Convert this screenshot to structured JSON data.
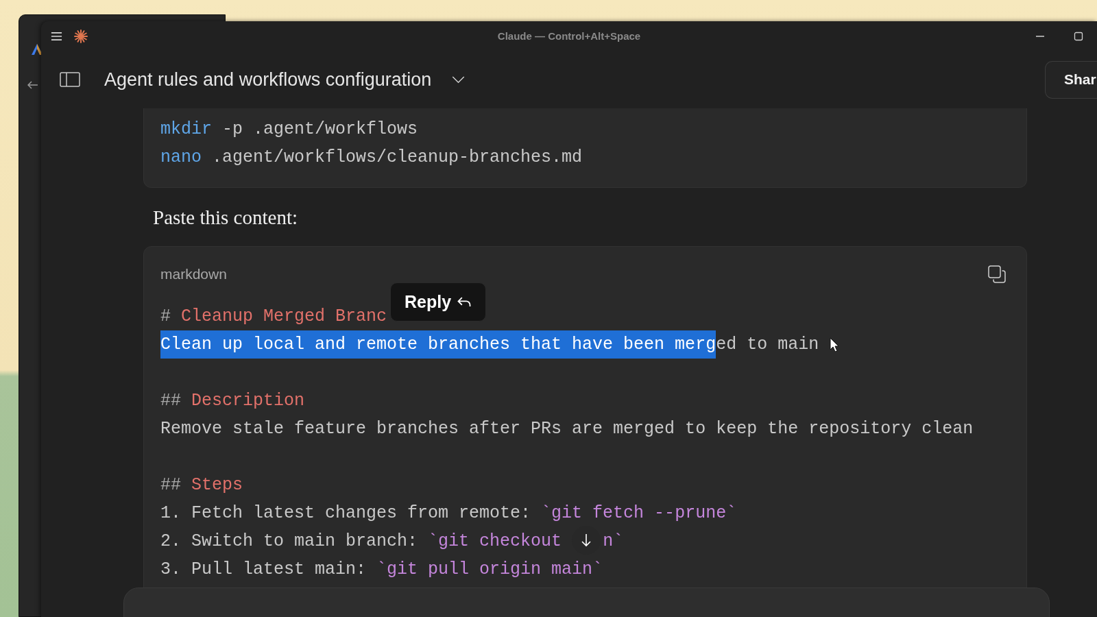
{
  "window": {
    "title": "Claude — Control+Alt+Space"
  },
  "header": {
    "title": "Agent rules and workflows configuration",
    "share_button": "Shar"
  },
  "command_block": {
    "lines": [
      {
        "kind": "code",
        "segments": [
          {
            "kind": "command",
            "text": "mkdir"
          },
          {
            "kind": "text",
            "text": " -p .agent/workflows"
          }
        ]
      },
      {
        "kind": "code",
        "segments": [
          {
            "kind": "command",
            "text": "nano"
          },
          {
            "kind": "text",
            "text": " .agent/workflows/cleanup-branches.md"
          }
        ]
      }
    ]
  },
  "paragraph": "Paste this content:",
  "code_block": {
    "language": "markdown",
    "reply_popup": "Reply",
    "lines": [
      {
        "kind": "code",
        "segments": [
          {
            "kind": "mark",
            "text": "# "
          },
          {
            "kind": "heading",
            "text": "Cleanup Merged Branc"
          }
        ]
      },
      {
        "kind": "code",
        "segments": [
          {
            "kind": "text",
            "text": "Clean up local and remote branches that have been merg",
            "selected": true
          },
          {
            "kind": "text",
            "text": "ed to main",
            "selected": false
          }
        ]
      },
      {
        "kind": "blank"
      },
      {
        "kind": "code",
        "segments": [
          {
            "kind": "mark",
            "text": "## "
          },
          {
            "kind": "heading",
            "text": "Description"
          }
        ]
      },
      {
        "kind": "code",
        "segments": [
          {
            "kind": "text",
            "text": "Remove stale feature branches after PRs are merged to keep the repository clean"
          }
        ]
      },
      {
        "kind": "blank"
      },
      {
        "kind": "code",
        "segments": [
          {
            "kind": "mark",
            "text": "## "
          },
          {
            "kind": "heading",
            "text": "Steps"
          }
        ]
      },
      {
        "kind": "code",
        "segments": [
          {
            "kind": "text",
            "text": "1. Fetch latest changes from remote: "
          },
          {
            "kind": "code",
            "text": "`git fetch --prune`"
          }
        ]
      },
      {
        "kind": "code",
        "segments": [
          {
            "kind": "text",
            "text": "2. Switch to main branch: "
          },
          {
            "kind": "code",
            "text": "`git checkout"
          },
          {
            "kind": "gap"
          },
          {
            "kind": "code",
            "text": "n`"
          }
        ]
      },
      {
        "kind": "code",
        "segments": [
          {
            "kind": "text",
            "text": "3. Pull latest main: "
          },
          {
            "kind": "code",
            "text": "`git pull origin main`"
          }
        ]
      }
    ]
  }
}
